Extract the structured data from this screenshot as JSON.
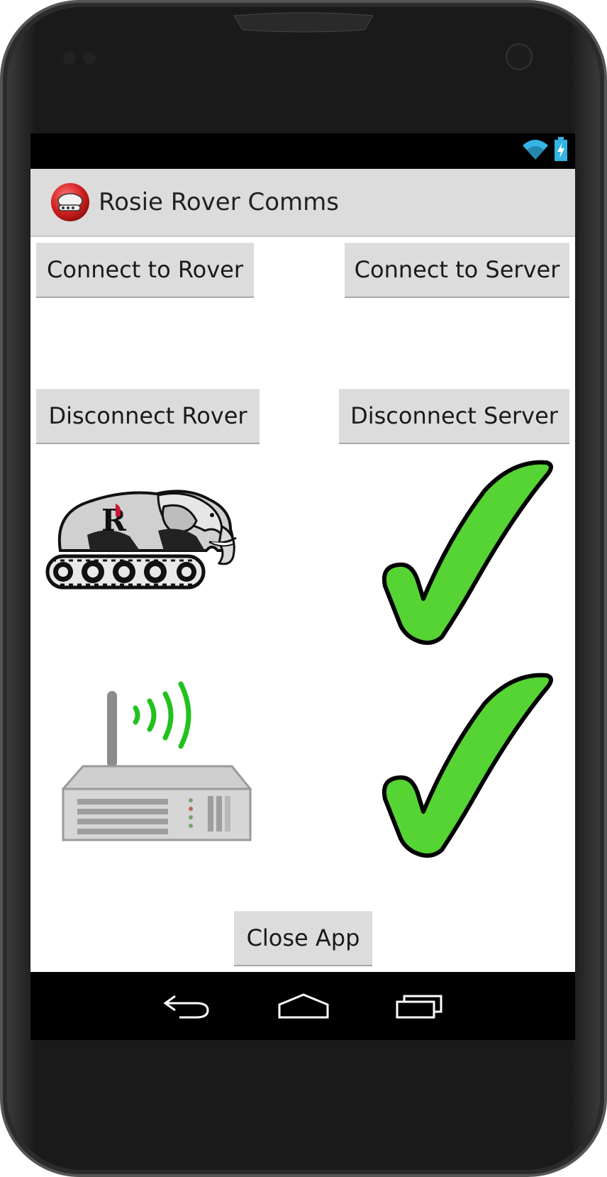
{
  "app": {
    "title": "Rosie Rover Comms"
  },
  "buttons": {
    "connect_rover": "Connect to Rover",
    "connect_server": "Connect to Server",
    "disconnect_rover": "Disconnect Rover",
    "disconnect_server": "Disconnect Server",
    "close_app": "Close App"
  },
  "status": {
    "rover_connected": true,
    "server_connected": true
  },
  "icons": {
    "app_icon": "rosie-rover-logo-icon",
    "rover_icon": "elephant-tank-icon",
    "router_icon": "wireless-router-icon",
    "rover_status_icon": "checkmark-icon",
    "server_status_icon": "checkmark-icon",
    "wifi_icon": "wifi-icon",
    "battery_icon": "battery-charging-icon",
    "back_icon": "back-icon",
    "home_icon": "home-icon",
    "recents_icon": "recent-apps-icon"
  },
  "colors": {
    "check_green": "#55d433",
    "status_blue": "#33b5e5",
    "action_bar": "#dcdcdc",
    "button": "#dcdcdc"
  }
}
